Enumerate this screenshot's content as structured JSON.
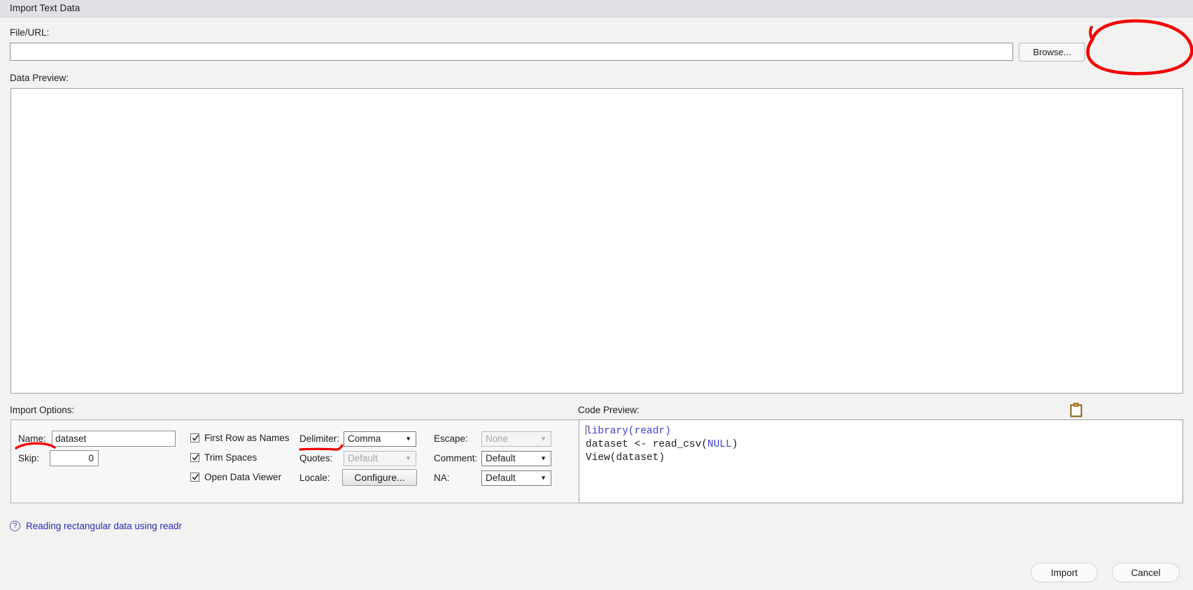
{
  "window": {
    "title": "Import Text Data"
  },
  "file_section": {
    "label": "File/URL:",
    "value": "",
    "placeholder": "",
    "browse_label": "Browse..."
  },
  "preview_section": {
    "label": "Data Preview:",
    "content": ""
  },
  "import_options": {
    "label": "Import Options:",
    "name_label": "Name:",
    "name_value": "dataset",
    "skip_label": "Skip:",
    "skip_value": "0",
    "checkboxes": [
      {
        "label": "First Row as Names",
        "checked": true
      },
      {
        "label": "Trim Spaces",
        "checked": true
      },
      {
        "label": "Open Data Viewer",
        "checked": true
      }
    ],
    "delimiter_label": "Delimiter:",
    "delimiter_value": "Comma",
    "quotes_label": "Quotes:",
    "quotes_value": "Default",
    "locale_label": "Locale:",
    "locale_button": "Configure...",
    "escape_label": "Escape:",
    "escape_value": "None",
    "comment_label": "Comment:",
    "comment_value": "Default",
    "na_label": "NA:",
    "na_value": "Default"
  },
  "code_preview": {
    "label": "Code Preview:",
    "copy_icon": "clipboard-icon",
    "lines": [
      "library(readr)",
      "dataset <- read_csv(NULL)",
      "View(dataset)"
    ],
    "line1_kw": "library",
    "line1_rest": "(readr)",
    "line2_a": "dataset <- read_csv(",
    "line2_null": "NULL",
    "line2_b": ")",
    "line3": "View(dataset)"
  },
  "footer": {
    "help_icon": "question-mark-icon",
    "help_text": "Reading rectangular data using readr",
    "import_label": "Import",
    "cancel_label": "Cancel"
  },
  "annotations": {
    "browse_circle": "red-ellipse-annotation",
    "name_underline": "red-underline-annotation",
    "delimiter_underline": "red-underline-annotation",
    "color": "#f20000"
  }
}
